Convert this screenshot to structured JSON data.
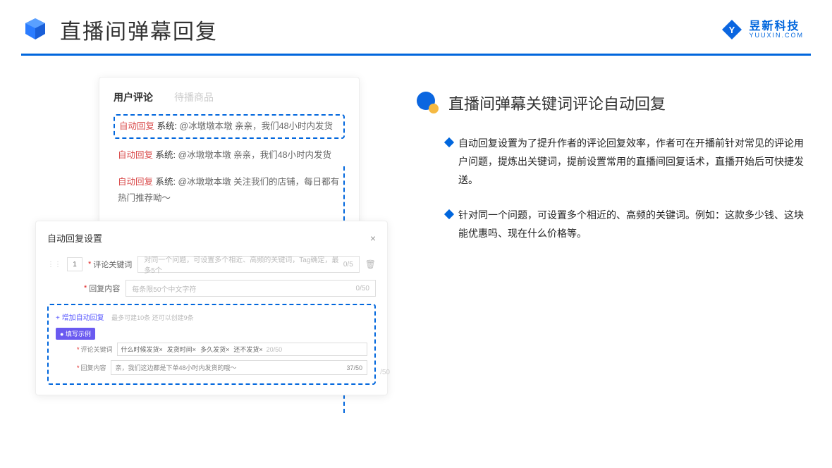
{
  "header": {
    "title": "直播间弹幕回复",
    "logo_cn": "昱新科技",
    "logo_en": "YUUXIN.COM"
  },
  "card1": {
    "tab_active": "用户评论",
    "tab_inactive": "待播商品",
    "comments": [
      {
        "auto": "自动回复",
        "sys": "系统:",
        "body": "@冰墩墩本墩 亲亲，我们48小时内发货"
      },
      {
        "auto": "自动回复",
        "sys": "系统:",
        "body": "@冰墩墩本墩 亲亲，我们48小时内发货"
      },
      {
        "auto": "自动回复",
        "sys": "系统:",
        "body": "@冰墩墩本墩 关注我们的店铺，每日都有热门推荐呦～"
      }
    ]
  },
  "card2": {
    "title": "自动回复设置",
    "order": "1",
    "label_keyword": "评论关键词",
    "placeholder_keyword": "对同一个问题，可设置多个相近、高频的关键词，Tag确定，最多5个",
    "counter_keyword": "0/5",
    "label_content": "回复内容",
    "placeholder_content": "每条限50个中文字符",
    "counter_content": "0/50",
    "add_link": "+ 增加自动回复",
    "add_note": "最多可建10条 还可以创建9条",
    "example_badge": "● 填写示例",
    "ex_label_keyword": "评论关键词",
    "ex_tags": [
      "什么时候发货×",
      "发货时间×",
      "多久发货×",
      "还不发货×"
    ],
    "ex_keyword_counter": "20/50",
    "ex_label_content": "回复内容",
    "ex_content": "亲，我们这边都是下单48小时内发货的哦～",
    "ex_content_counter": "37/50",
    "faded_counter": "/50"
  },
  "right": {
    "title": "直播间弹幕关键词评论自动回复",
    "bullet1": "自动回复设置为了提升作者的评论回复效率，作者可在开播前针对常见的评论用户问题，提炼出关键词，提前设置常用的直播间回复话术，直播开始后可快捷发送。",
    "bullet2": "针对同一个问题，可设置多个相近的、高频的关键词。例如：这款多少钱、这块能优惠吗、现在什么价格等。"
  }
}
